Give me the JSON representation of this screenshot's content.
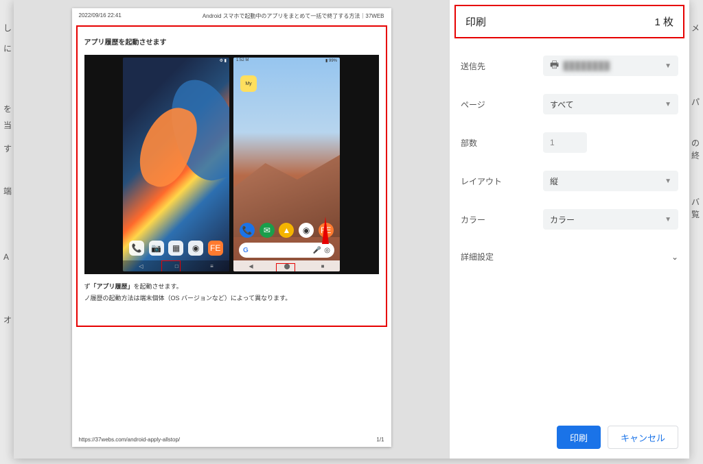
{
  "background_hints": [
    "し",
    "に",
    "を",
    "当",
    "す",
    "端",
    "A",
    "オ",
    "メ",
    "パ",
    "の",
    "終",
    "バ",
    "覧"
  ],
  "preview": {
    "timestamp": "2022/09/16 22:41",
    "title": "Android スマホで起動中のアプリをまとめて一括で終了する方法｜37WEB",
    "heading": "アプリ履歴を起動させます",
    "body_line1_prefix": "ず",
    "body_line1_bold": "「アプリ履歴」",
    "body_line1_suffix": "を起動させます。",
    "body_line2": "ノ履歴の起動方法は端末個体（OS バージョンなど）によって異なります。",
    "footer_url": "https://37webs.com/android-apply-allstop/",
    "footer_page": "1/1",
    "phone1_time": "",
    "phone2_time": "1:52 M",
    "app_label": "My",
    "g_label": "G"
  },
  "settings": {
    "header_title": "印刷",
    "header_count": "1 枚",
    "rows": {
      "destination_label": "送信先",
      "destination_value": "████████",
      "pages_label": "ページ",
      "pages_value": "すべて",
      "copies_label": "部数",
      "copies_value": "1",
      "layout_label": "レイアウト",
      "layout_value": "縦",
      "color_label": "カラー",
      "color_value": "カラー"
    },
    "advanced_label": "詳細設定",
    "print_button": "印刷",
    "cancel_button": "キャンセル"
  }
}
